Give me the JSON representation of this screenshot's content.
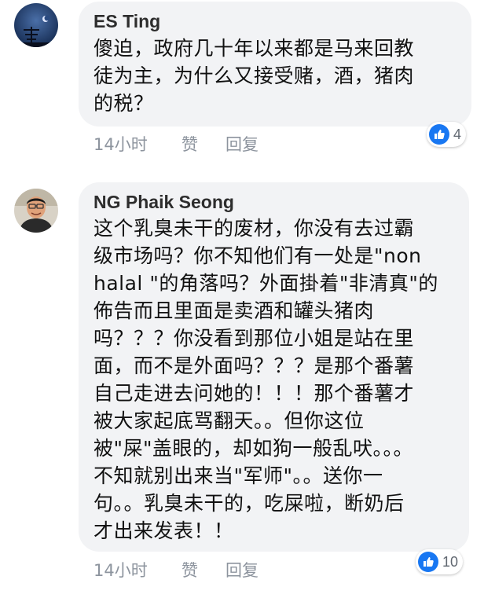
{
  "comments": [
    {
      "author": "ES Ting",
      "text": "傻迫，政府几十年以来都是马来回教\n徒为主，为什么又接受赌，酒，猪肉\n的税？",
      "time": "14小时",
      "like_label": "赞",
      "reply_label": "回复",
      "reaction_count": "4",
      "avatar_icon": "night-sky-antenna-avatar"
    },
    {
      "author": "NG Phaik Seong",
      "text": "这个乳臭未干的废材，你没有去过霸\n级市场吗？你不知他们有一处是\"non\nhalal \"的角落吗？外面掛着\"非清真\"的\n佈告而且里面是卖酒和罐头猪肉\n吗？？？你没看到那位小姐是站在里\n面，而不是外面吗？？？是那个番薯\n自己走进去问她的！！！那个番薯才\n被大家起底骂翻天。。但你这位\n被\"屎\"盖眼的，却如狗一般乱吠。。。\n不知就别出来当\"军师\"。。送你一\n句。。乳臭未干的，吃屎啦，断奶后\n才出来发表！！",
      "time": "14小时",
      "like_label": "赞",
      "reply_label": "回复",
      "reaction_count": "10",
      "avatar_icon": "man-portrait-avatar"
    }
  ],
  "colors": {
    "bubble": "#f2f3f5",
    "like_blue": "#1877f2",
    "meta_gray": "#8d949e"
  }
}
